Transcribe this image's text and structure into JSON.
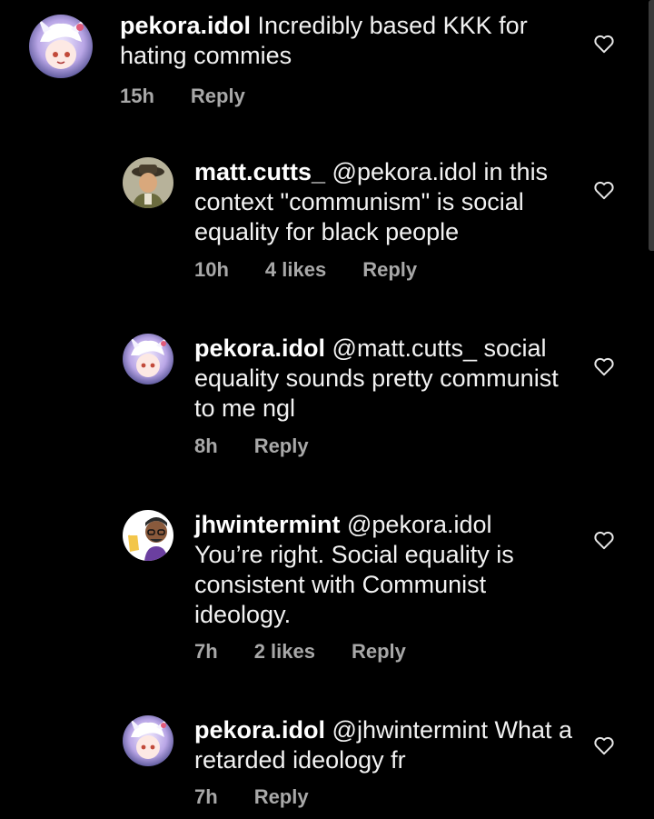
{
  "comments": [
    {
      "username": "pekora.idol",
      "text": " Incredibly based KKK for hating commies",
      "time": "15h",
      "likes": "",
      "reply_label": "Reply"
    },
    {
      "username": "matt.cutts_",
      "text": " @pekora.idol in this context \"communism\" is social equality for black people",
      "time": "10h",
      "likes": "4 likes",
      "reply_label": "Reply"
    },
    {
      "username": "pekora.idol",
      "text": " @matt.cutts_ social equality sounds pretty communist to me ngl",
      "time": "8h",
      "likes": "",
      "reply_label": "Reply"
    },
    {
      "username": "jhwintermint",
      "text": " @pekora.idol You’re right. Social equality is consistent with Communist ideology.",
      "time": "7h",
      "likes": "2 likes",
      "reply_label": "Reply"
    },
    {
      "username": "pekora.idol",
      "text": " @jhwintermint What a retarded ideology fr",
      "time": "7h",
      "likes": "",
      "reply_label": "Reply"
    }
  ],
  "icons": {
    "heart": "heart-outline-icon"
  },
  "colors": {
    "background": "#000000",
    "text": "#f2f2f2",
    "meta": "#a8a8a8"
  }
}
